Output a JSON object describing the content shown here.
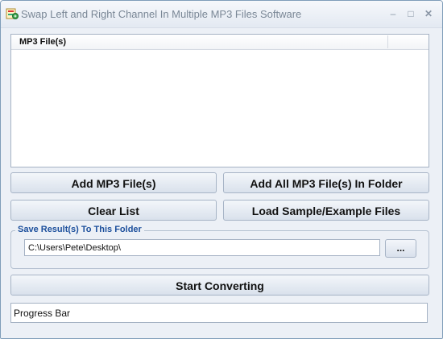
{
  "window": {
    "title": "Swap Left and Right Channel In Multiple MP3 Files Software",
    "minimize_glyph": "–",
    "maximize_glyph": "□",
    "close_glyph": "✕"
  },
  "file_list": {
    "columns": [
      "MP3 File(s)"
    ],
    "items": []
  },
  "buttons": {
    "add_files": "Add MP3 File(s)",
    "add_folder": "Add All MP3 File(s) In Folder",
    "clear_list": "Clear List",
    "load_samples": "Load Sample/Example Files",
    "start": "Start Converting"
  },
  "output": {
    "group_label": "Save Result(s) To This Folder",
    "folder_path": "C:\\Users\\Pete\\Desktop\\",
    "browse_label": "..."
  },
  "progress": {
    "label": "Progress Bar",
    "value": 0
  },
  "icons": {
    "app": "app-icon"
  }
}
